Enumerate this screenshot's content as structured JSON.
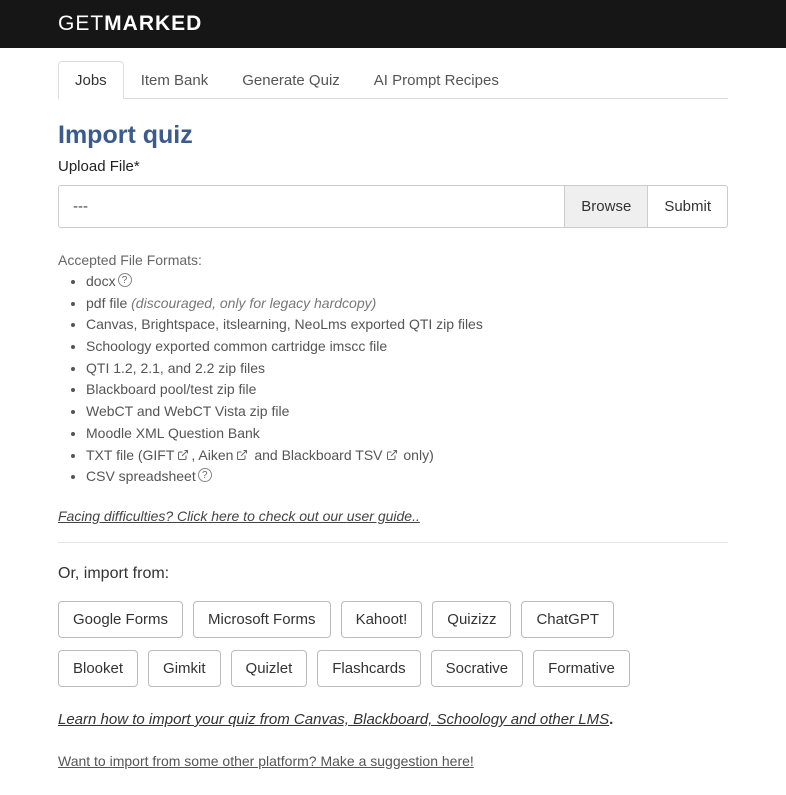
{
  "brand": {
    "part1": "GET",
    "part2": "MARKED"
  },
  "tabs": [
    "Jobs",
    "Item Bank",
    "Generate Quiz",
    "AI Prompt Recipes"
  ],
  "active_tab": 0,
  "page_title": "Import quiz",
  "upload_label": "Upload File*",
  "file_placeholder": "---",
  "browse_label": "Browse",
  "submit_label": "Submit",
  "accepted_label": "Accepted File Formats:",
  "formats": {
    "docx": "docx",
    "pdf_prefix": "pdf file ",
    "pdf_note": "(discouraged, only for legacy hardcopy)",
    "qti_export": "Canvas, Brightspace, itslearning, NeoLms exported QTI zip files",
    "schoology": "Schoology exported common cartridge imscc file",
    "qti_zip": "QTI 1.2, 2.1, and 2.2 zip files",
    "blackboard": "Blackboard pool/test zip file",
    "webct": "WebCT and WebCT Vista zip file",
    "moodle": "Moodle XML Question Bank",
    "txt_prefix": "TXT file (GIFT",
    "txt_mid1": ", Aiken",
    "txt_mid2": " and Blackboard TSV",
    "txt_suffix": " only)",
    "csv": "CSV spreadsheet"
  },
  "guide_link": "Facing difficulties? Click here to check out our user guide..",
  "import_label": "Or, import from:",
  "providers_row1": [
    "Google Forms",
    "Microsoft Forms",
    "Kahoot!",
    "Quizizz",
    "ChatGPT"
  ],
  "providers_row2": [
    "Blooket",
    "Gimkit",
    "Quizlet",
    "Flashcards",
    "Socrative",
    "Formative"
  ],
  "lms_link_text": "Learn how to import your quiz from Canvas, Blackboard, Schoology and other LMS",
  "lms_link_dot": ".",
  "suggest_link": "Want to import from some other platform? Make a suggestion here!"
}
